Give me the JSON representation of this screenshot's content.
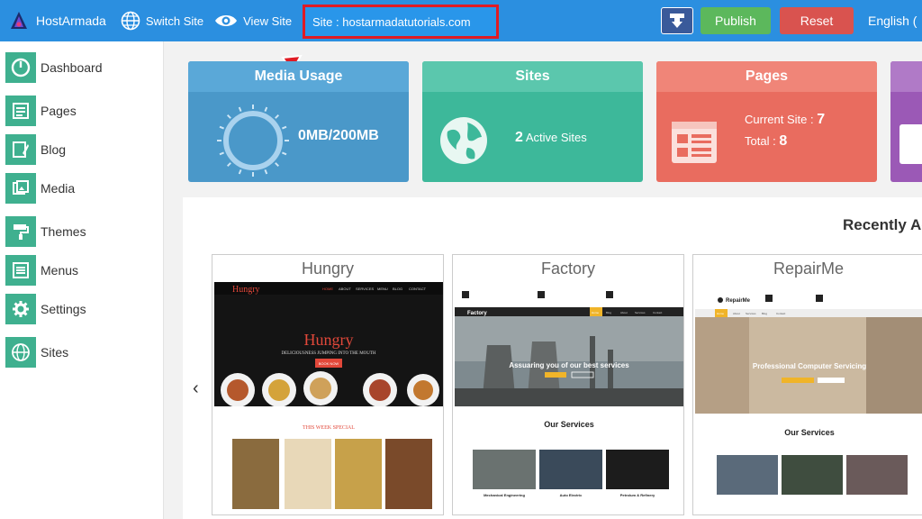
{
  "topbar": {
    "brand": "HostArmada",
    "switch_site": "Switch Site",
    "view_site": "View Site",
    "site_label": "Site : hostarmadatutorials.com",
    "publish": "Publish",
    "reset": "Reset",
    "language": "English ("
  },
  "sidebar": {
    "items": [
      {
        "label": "Dashboard",
        "icon": "dashboard-icon"
      },
      {
        "label": "Pages",
        "icon": "pages-icon"
      },
      {
        "label": "Blog",
        "icon": "blog-icon"
      },
      {
        "label": "Media",
        "icon": "media-icon"
      },
      {
        "label": "Themes",
        "icon": "paint-roller-icon"
      },
      {
        "label": "Menus",
        "icon": "menu-list-icon"
      },
      {
        "label": "Settings",
        "icon": "gear-icon"
      },
      {
        "label": "Sites",
        "icon": "globe-icon"
      }
    ]
  },
  "cards": {
    "media": {
      "title": "Media Usage",
      "value": "0MB/200MB"
    },
    "sites": {
      "title": "Sites",
      "count": "2",
      "label": "Active Sites"
    },
    "pages": {
      "title": "Pages",
      "current_label": "Current Site :",
      "current_value": "7",
      "total_label": "Total :",
      "total_value": "8"
    }
  },
  "recent": {
    "title": "Recently Ac"
  },
  "templates": [
    {
      "name": "Hungry",
      "logo": "Hungry",
      "nav": [
        "HOME",
        "ABOUT",
        "SERVICES",
        "MENU",
        "BLOG",
        "CONTACT"
      ],
      "hero": "Hungry",
      "tagline": "DELICIOUSNESS JUMPING INTO THE MOUTH",
      "button": "BOOK NOW",
      "section": "THIS WEEK SPECIAL"
    },
    {
      "name": "Factory",
      "logo": "Factory",
      "nav": [
        "Home",
        "Blog",
        "About",
        "Services",
        "Contact"
      ],
      "hero": "Assuaring you of our best services",
      "section": "Our Services",
      "services": [
        "Mechanical Engineering",
        "Auto Electric",
        "Petrolum & Refinery"
      ]
    },
    {
      "name": "RepairMe",
      "logo": "RepairMe",
      "nav": [
        "Home",
        "About",
        "Services",
        "Blog",
        "Contact"
      ],
      "hero": "Professional Computer Servicing",
      "section": "Our Services"
    }
  ],
  "colors": {
    "topbar": "#2b8fe0",
    "highlight": "#e01b24",
    "sidebar_icon": "#3fb08f",
    "publish": "#5cb85c",
    "reset": "#d9534f"
  }
}
